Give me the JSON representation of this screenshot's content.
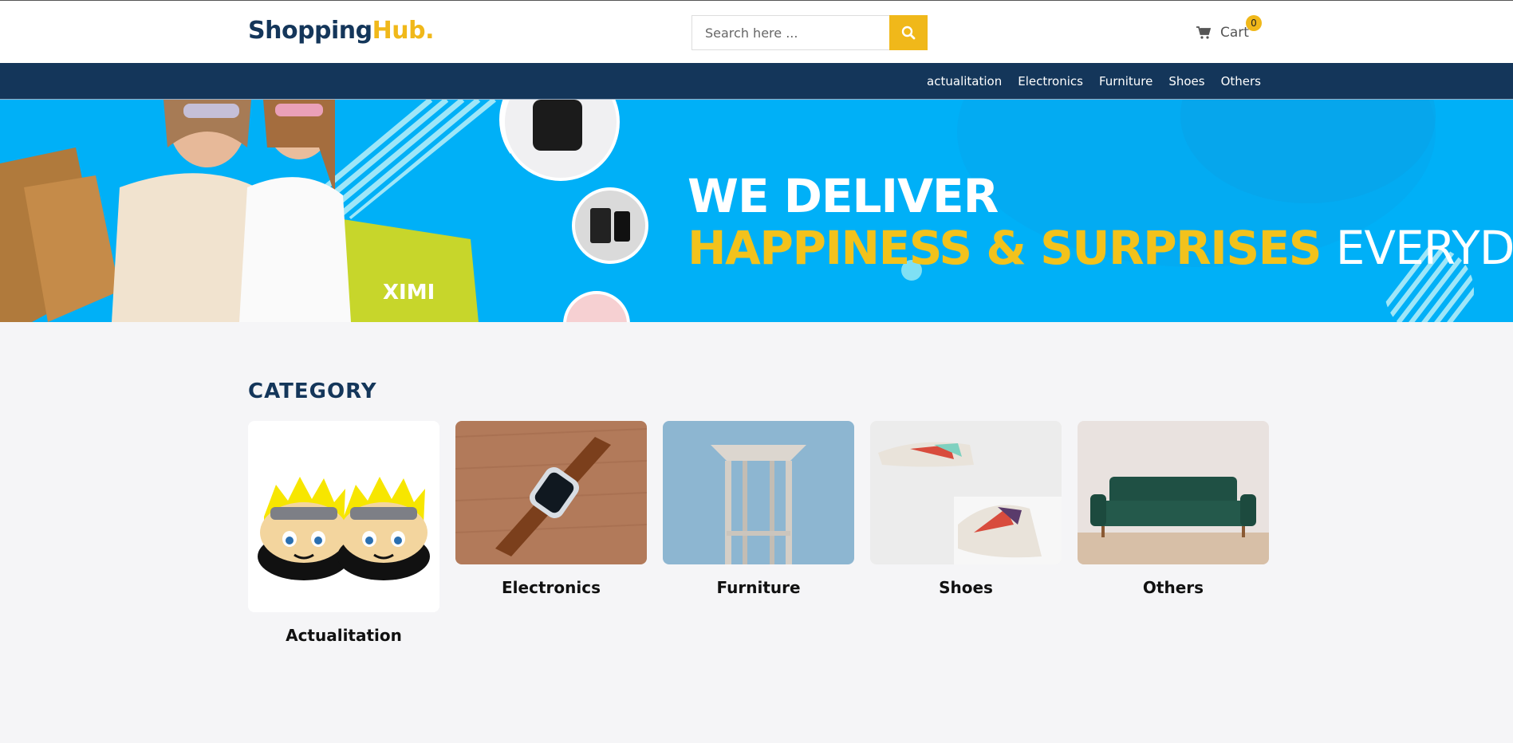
{
  "header": {
    "logo_part1": "Shopping",
    "logo_part2": "Hub.",
    "search_placeholder": "Search here ...",
    "search_icon": "search-icon",
    "cart_label": "Cart",
    "cart_icon": "cart-icon",
    "cart_count": "0"
  },
  "nav": {
    "items": [
      "actualitation",
      "Electronics",
      "Furniture",
      "Shoes",
      "Others"
    ]
  },
  "banner": {
    "line1": "WE DELIVER",
    "line2_highlight": "HAPPINESS & SURPRISES",
    "line2_rest": "EVERYDAY",
    "photo_text": "XIMI"
  },
  "category": {
    "title": "CATEGORY",
    "items": [
      {
        "label": "Actualitation",
        "image": "plush-slippers"
      },
      {
        "label": "Electronics",
        "image": "smartwatch"
      },
      {
        "label": "Furniture",
        "image": "stool"
      },
      {
        "label": "Shoes",
        "image": "sneakers"
      },
      {
        "label": "Others",
        "image": "green-sofa"
      }
    ]
  },
  "colors": {
    "brand_dark": "#14365a",
    "brand_accent": "#f0b81a",
    "banner_bg": "#00b0f7"
  }
}
